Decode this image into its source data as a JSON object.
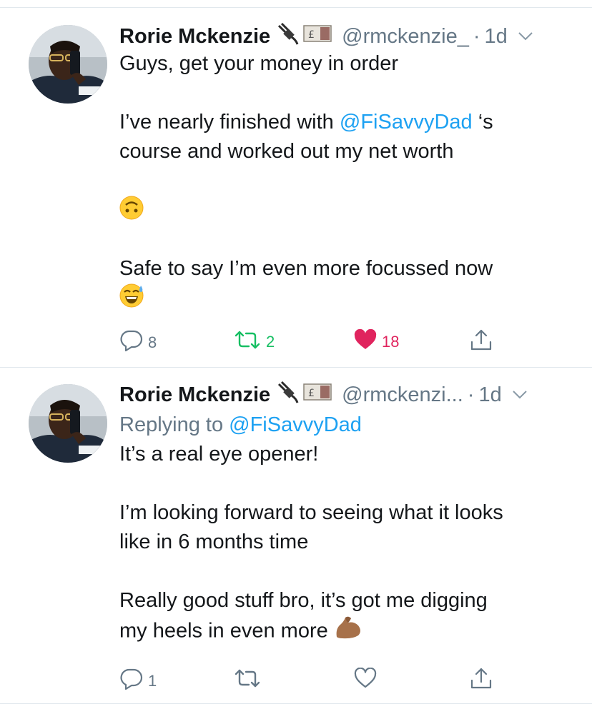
{
  "tweets": [
    {
      "author_name": "Rorie Mckenzie",
      "handle": "@rmckenzie_",
      "dot": "·",
      "time": "1d",
      "reply_prefix": "",
      "reply_mention": "",
      "line1": "Guys, get your money in order",
      "line2_pre": "I’ve nearly finished with ",
      "line2_mention": "@FiSavvyDad",
      "line2_post": " ‘s",
      "line3": "course and worked out my net worth",
      "line4": "Safe to say I’m even more focussed now",
      "replies": "8",
      "retweets": "2",
      "likes": "18",
      "liked": true,
      "retweeted": true
    },
    {
      "author_name": "Rorie Mckenzie",
      "handle": "@rmckenzi...",
      "dot": "·",
      "time": "1d",
      "reply_prefix": "Replying to ",
      "reply_mention": "@FiSavvyDad",
      "line1": "It’s a real eye opener!",
      "line2": "I’m looking forward to seeing what it looks",
      "line3": "like in 6 months time",
      "line4": "Really good stuff bro, it’s got me digging",
      "line5": "my heels in even more",
      "replies": "1",
      "retweets": "",
      "likes": "",
      "liked": false,
      "retweeted": false
    }
  ],
  "icons": {
    "badge_1": "plug-icon",
    "badge_2": "pound-banknote-icon",
    "reply": "reply-icon",
    "retweet": "retweet-icon",
    "like": "heart-icon",
    "share": "share-icon",
    "more": "chevron-down-icon",
    "emoji_upside_down": "upside-down-face-emoji",
    "emoji_sweat_smile": "sweat-smile-emoji",
    "emoji_flex": "flexed-biceps-emoji"
  },
  "colors": {
    "link": "#1da1f2",
    "secondary_text": "#657786",
    "like_active": "#e0245e",
    "retweet_active": "#17bf63",
    "divider": "#e1e8ed"
  }
}
